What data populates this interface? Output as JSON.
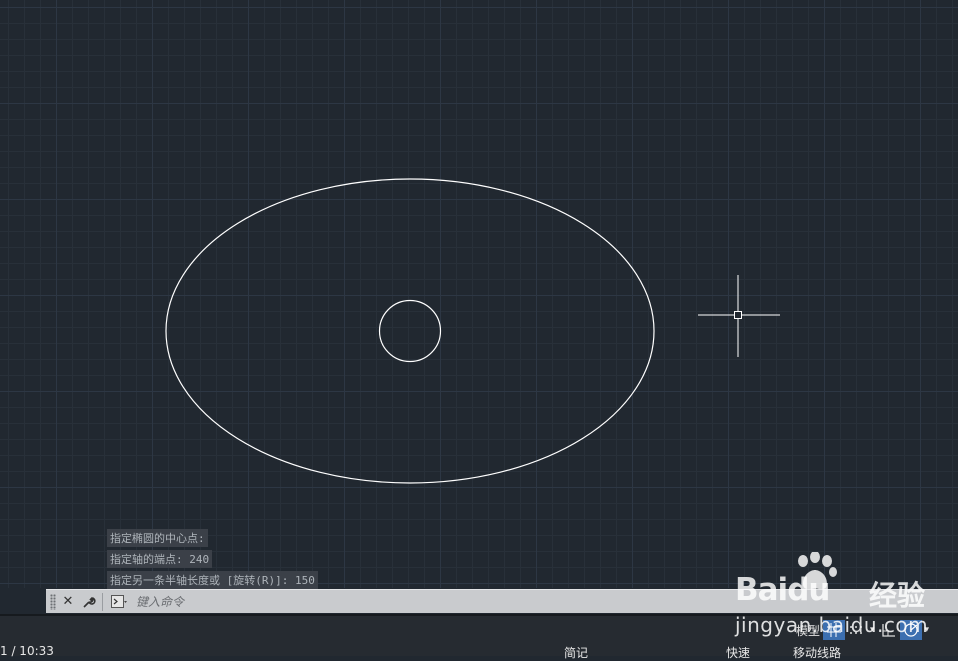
{
  "command_history": [
    "指定椭圆的中心点:",
    "指定轴的端点: 240",
    "指定另一条半轴长度或 [旋转(R)]: 150"
  ],
  "command_line": {
    "placeholder": "键入命令",
    "close_icon": "close-icon",
    "settings_icon": "wrench-icon",
    "prompt_icon": "command-prompt-icon"
  },
  "status_bar": {
    "left_text": "1 / 10:33",
    "item_1": "简记",
    "item_2": "快速",
    "item_3": "移动线路",
    "model_label": "模型",
    "buttons": [
      "grid-icon",
      "snap-icon",
      "ortho-icon",
      "polar-icon",
      "dropdown-icon"
    ]
  },
  "watermark": {
    "logo_text_a": "Bai",
    "logo_text_b": "du",
    "logo_cn": "经验",
    "url": "jingyan.baidu.com"
  },
  "colors": {
    "canvas_bg": "#212830",
    "geometry": "#ffffff",
    "command_bar_bg": "#c9cbce",
    "status_active": "#3c6fb0"
  }
}
